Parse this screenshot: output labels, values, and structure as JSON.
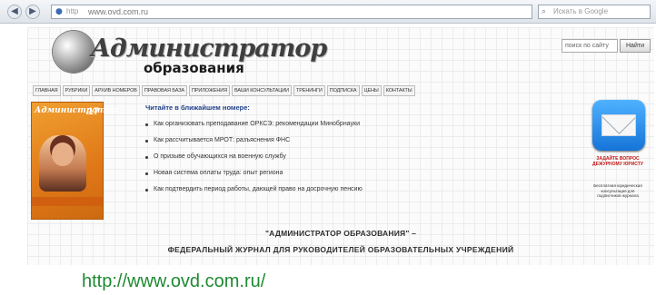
{
  "browser": {
    "address": "www.ovd.com.ru",
    "protocol": "http",
    "search_placeholder": "Искать в Google"
  },
  "site": {
    "logo_script": "Администратор",
    "logo_sub": "образования",
    "search_value": "поиск по сайту",
    "search_button": "Найти",
    "nav": [
      "ГЛАВНАЯ",
      "РУБРИКИ",
      "АРХИВ НОМЕРОВ",
      "ПРАВОВАЯ БАЗА",
      "ПРИЛОЖЕНИЯ",
      "ВАШИ КОНСУЛЬТАЦИИ",
      "ТРЕНИНГИ",
      "ПОДПИСКА",
      "ЦЕНЫ",
      "КОНТАКТЫ"
    ],
    "cover": {
      "title": "Администратор",
      "number": "17"
    },
    "articles_heading": "Читайте в ближайшем номере:",
    "articles": [
      "Как организовать преподавание ОРКСЭ: рекомендации Минобрнауки",
      "Как рассчитывается МРОТ: разъяснения ФНС",
      "О призыве обучающихся на военную службу",
      "Новая система оплаты труда: опыт региона",
      "Как подтвердить период работы, дающей право на досрочную пенсию"
    ],
    "tagline_1": "\"АДМИНИСТРАТОР ОБРАЗОВАНИЯ\" –",
    "tagline_2": "ФЕДЕРАЛЬНЫЙ ЖУРНАЛ ДЛЯ РУКОВОДИТЕЛЕЙ ОБРАЗОВАТЕЛЬНЫХ УЧРЕЖДЕНИЙ",
    "promo_title": "ЗАДАЙТЕ ВОПРОС ДЕЖУРНОМУ ЮРИСТУ",
    "promo_text": "Бесплатная юридическая консультация для подписчиков журнала"
  },
  "footer_url": "http://www.ovd.com.ru/"
}
